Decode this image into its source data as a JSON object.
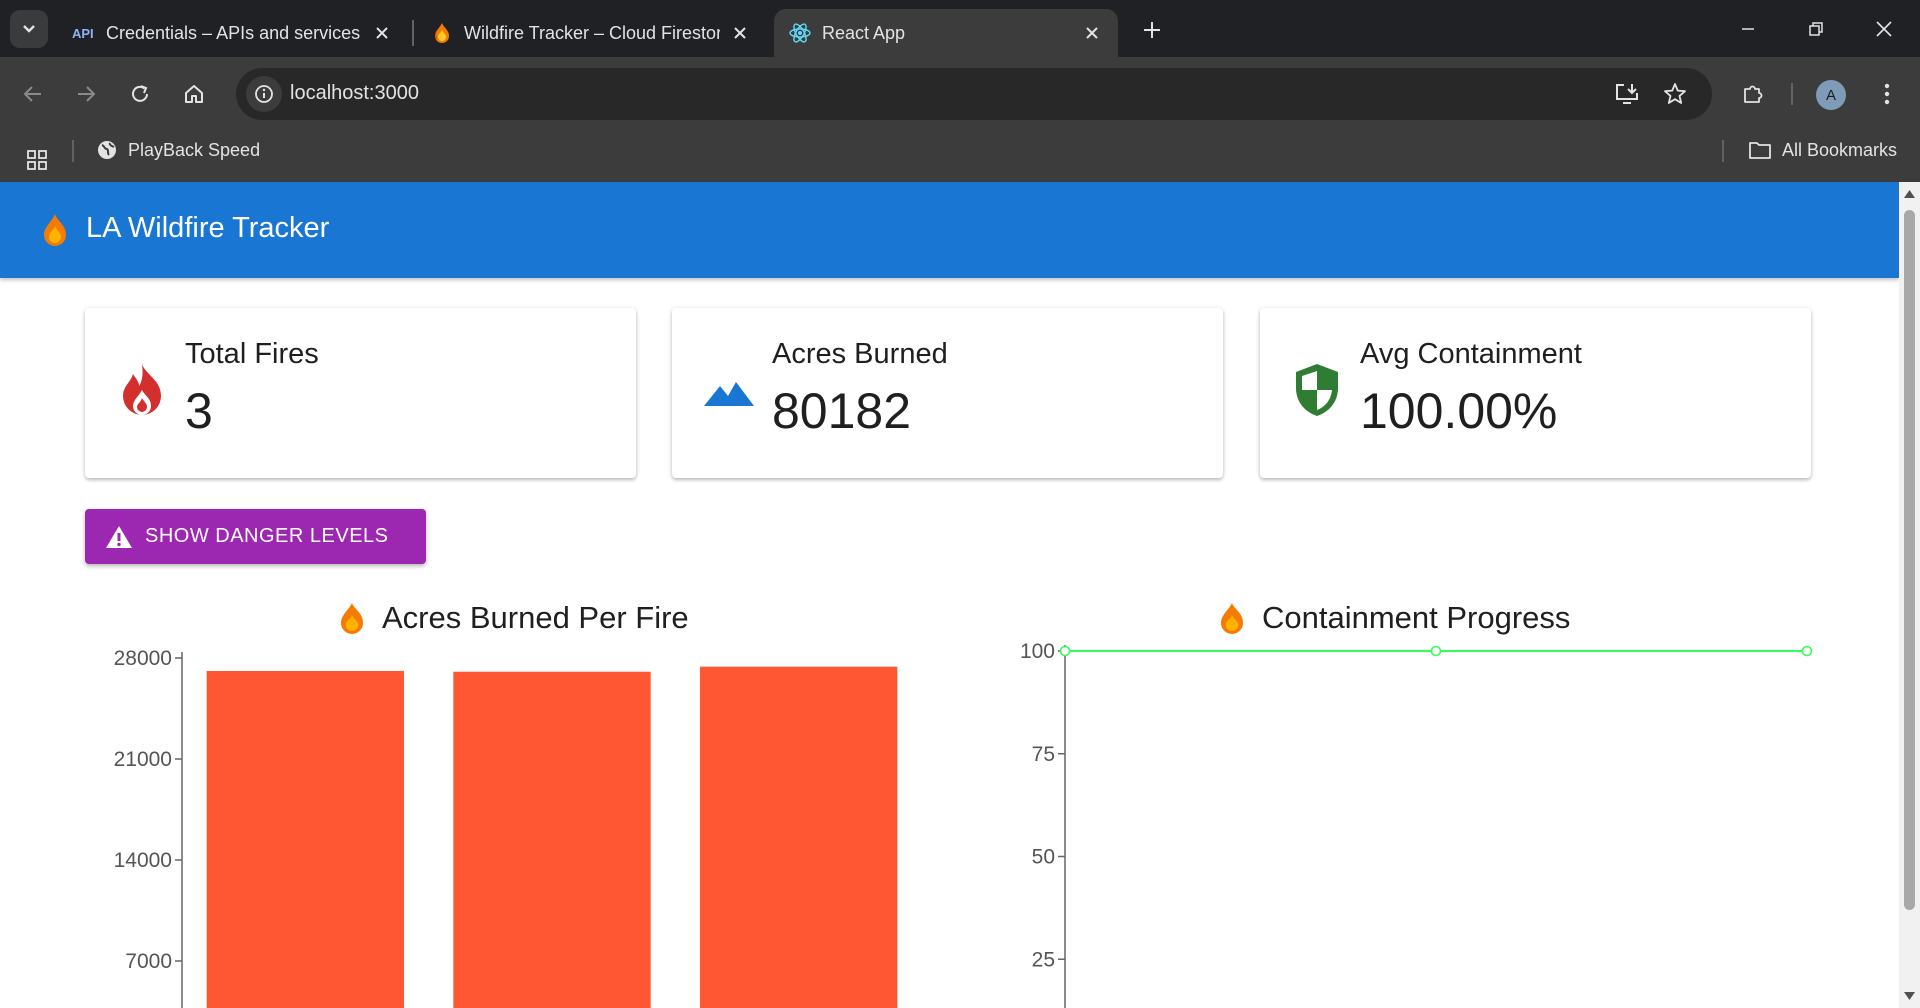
{
  "browser": {
    "tabs": [
      {
        "label": "Credentials – APIs and services",
        "favicon": "api-icon"
      },
      {
        "label": "Wildfire Tracker – Cloud Firestore",
        "favicon": "firebase-icon"
      },
      {
        "label": "React App",
        "favicon": "react-icon"
      }
    ],
    "url": "localhost:3000",
    "bookmarks": {
      "playback": "PlayBack Speed",
      "all": "All Bookmarks"
    },
    "profile_initial": "A"
  },
  "app": {
    "title": "LA Wildfire Tracker",
    "stats": [
      {
        "label": "Total Fires",
        "value": "3",
        "icon": "fire-icon",
        "color": "#d32f2f"
      },
      {
        "label": "Acres Burned",
        "value": "80182",
        "icon": "landscape-icon",
        "color": "#1976d2"
      },
      {
        "label": "Avg Containment",
        "value": "100.00%",
        "icon": "shield-icon",
        "color": "#2e7d32"
      }
    ],
    "danger_button": "SHOW DANGER LEVELS",
    "colors": {
      "appbar": "#1976d2",
      "button": "#9c27b0",
      "bar": "#ff5733",
      "line": "#33ff57"
    }
  },
  "chart_data": [
    {
      "type": "bar",
      "title": "Acres Burned Per Fire",
      "yticks": [
        "28000",
        "21000",
        "14000",
        "7000"
      ],
      "ytick_values": [
        28000,
        21000,
        14000,
        7000
      ],
      "ylim": [
        0,
        28000
      ],
      "values": [
        27100,
        27050,
        27400
      ],
      "color": "#ff5733"
    },
    {
      "type": "line",
      "title": "Containment Progress",
      "yticks": [
        "100",
        "75",
        "50",
        "25"
      ],
      "ytick_values": [
        100,
        75,
        50,
        25
      ],
      "ylim": [
        0,
        100
      ],
      "values": [
        100,
        100,
        100
      ],
      "color": "#33ff57"
    }
  ]
}
